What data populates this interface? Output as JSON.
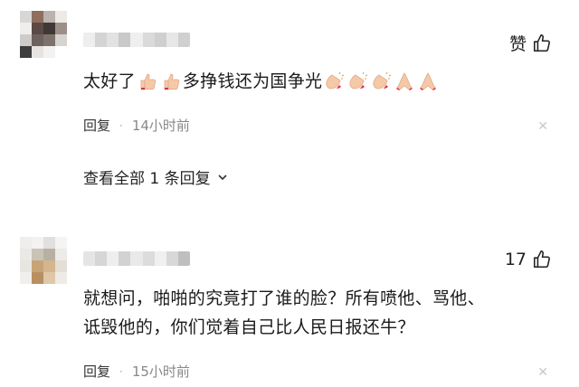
{
  "comments": [
    {
      "text_parts": [
        "太好了",
        "多挣钱还为国争光"
      ],
      "likes_label": "赞",
      "reply_label": "回复",
      "time": "14小时前",
      "view_replies": "查看全部 1 条回复"
    },
    {
      "line1": "就想问，啪啪的究竟打了谁的脸？所有喷他、骂他、",
      "line2": "诋毁他的，你们觉着自己比人民日报还牛？",
      "likes": "17",
      "reply_label": "回复",
      "time": "15小时前"
    }
  ],
  "icons": {
    "like": "thumbs-up-icon",
    "close": "close-icon",
    "chevron": "chevron-down-icon",
    "emoji_thumbs": "thumbs-up-emoji",
    "emoji_clap": "clapping-hands-emoji",
    "emoji_pray": "folded-hands-emoji"
  },
  "colors": {
    "text": "#1a1a1a",
    "muted": "#888888",
    "skin": "#f5c9a8",
    "nail": "#e0304a"
  }
}
